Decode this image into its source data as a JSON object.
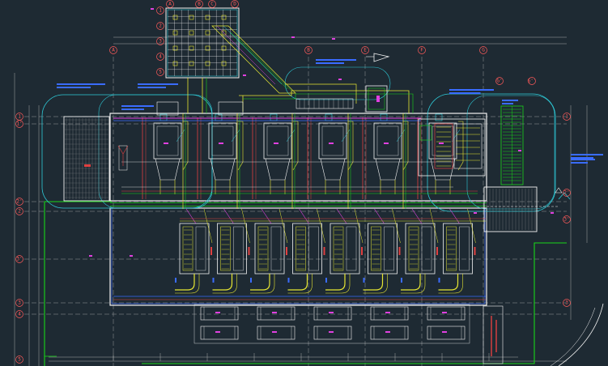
{
  "drawing": {
    "background": "#1e2a33",
    "colors": {
      "wall": "#f2f2f2",
      "grid": "#c8c8c8",
      "gridBubble": "#ff5a5a",
      "cyan": "#2ec9d6",
      "green": "#19d619",
      "yellow": "#e6e633",
      "red": "#e04040",
      "magenta": "#e040e0",
      "blue": "#3a6cff",
      "hatch": "#8a8a8a"
    }
  },
  "grid": {
    "columns": [
      {
        "label": "A"
      },
      {
        "label": "B"
      },
      {
        "label": "E"
      },
      {
        "label": "F"
      },
      {
        "label": "G"
      },
      {
        "label": "G'"
      },
      {
        "label": "G''"
      }
    ],
    "rows_left": [
      {
        "label": "1"
      },
      {
        "label": "1'"
      },
      {
        "label": "2"
      },
      {
        "label": "2'"
      },
      {
        "label": "3"
      },
      {
        "label": "3'"
      },
      {
        "label": "4"
      },
      {
        "label": "5"
      }
    ],
    "rows_right": [
      {
        "label": "1"
      },
      {
        "label": "2'"
      },
      {
        "label": "3"
      },
      {
        "label": "3'"
      }
    ],
    "inset_rows": [
      {
        "label": "1"
      },
      {
        "label": "2"
      },
      {
        "label": "3"
      },
      {
        "label": "4"
      },
      {
        "label": "5"
      }
    ],
    "inset_cols": [
      {
        "label": "A"
      },
      {
        "label": "B"
      },
      {
        "label": "C"
      },
      {
        "label": "D"
      }
    ]
  },
  "equipment": {
    "upper_units": 6,
    "lower_units": 8,
    "tanks": 10
  }
}
